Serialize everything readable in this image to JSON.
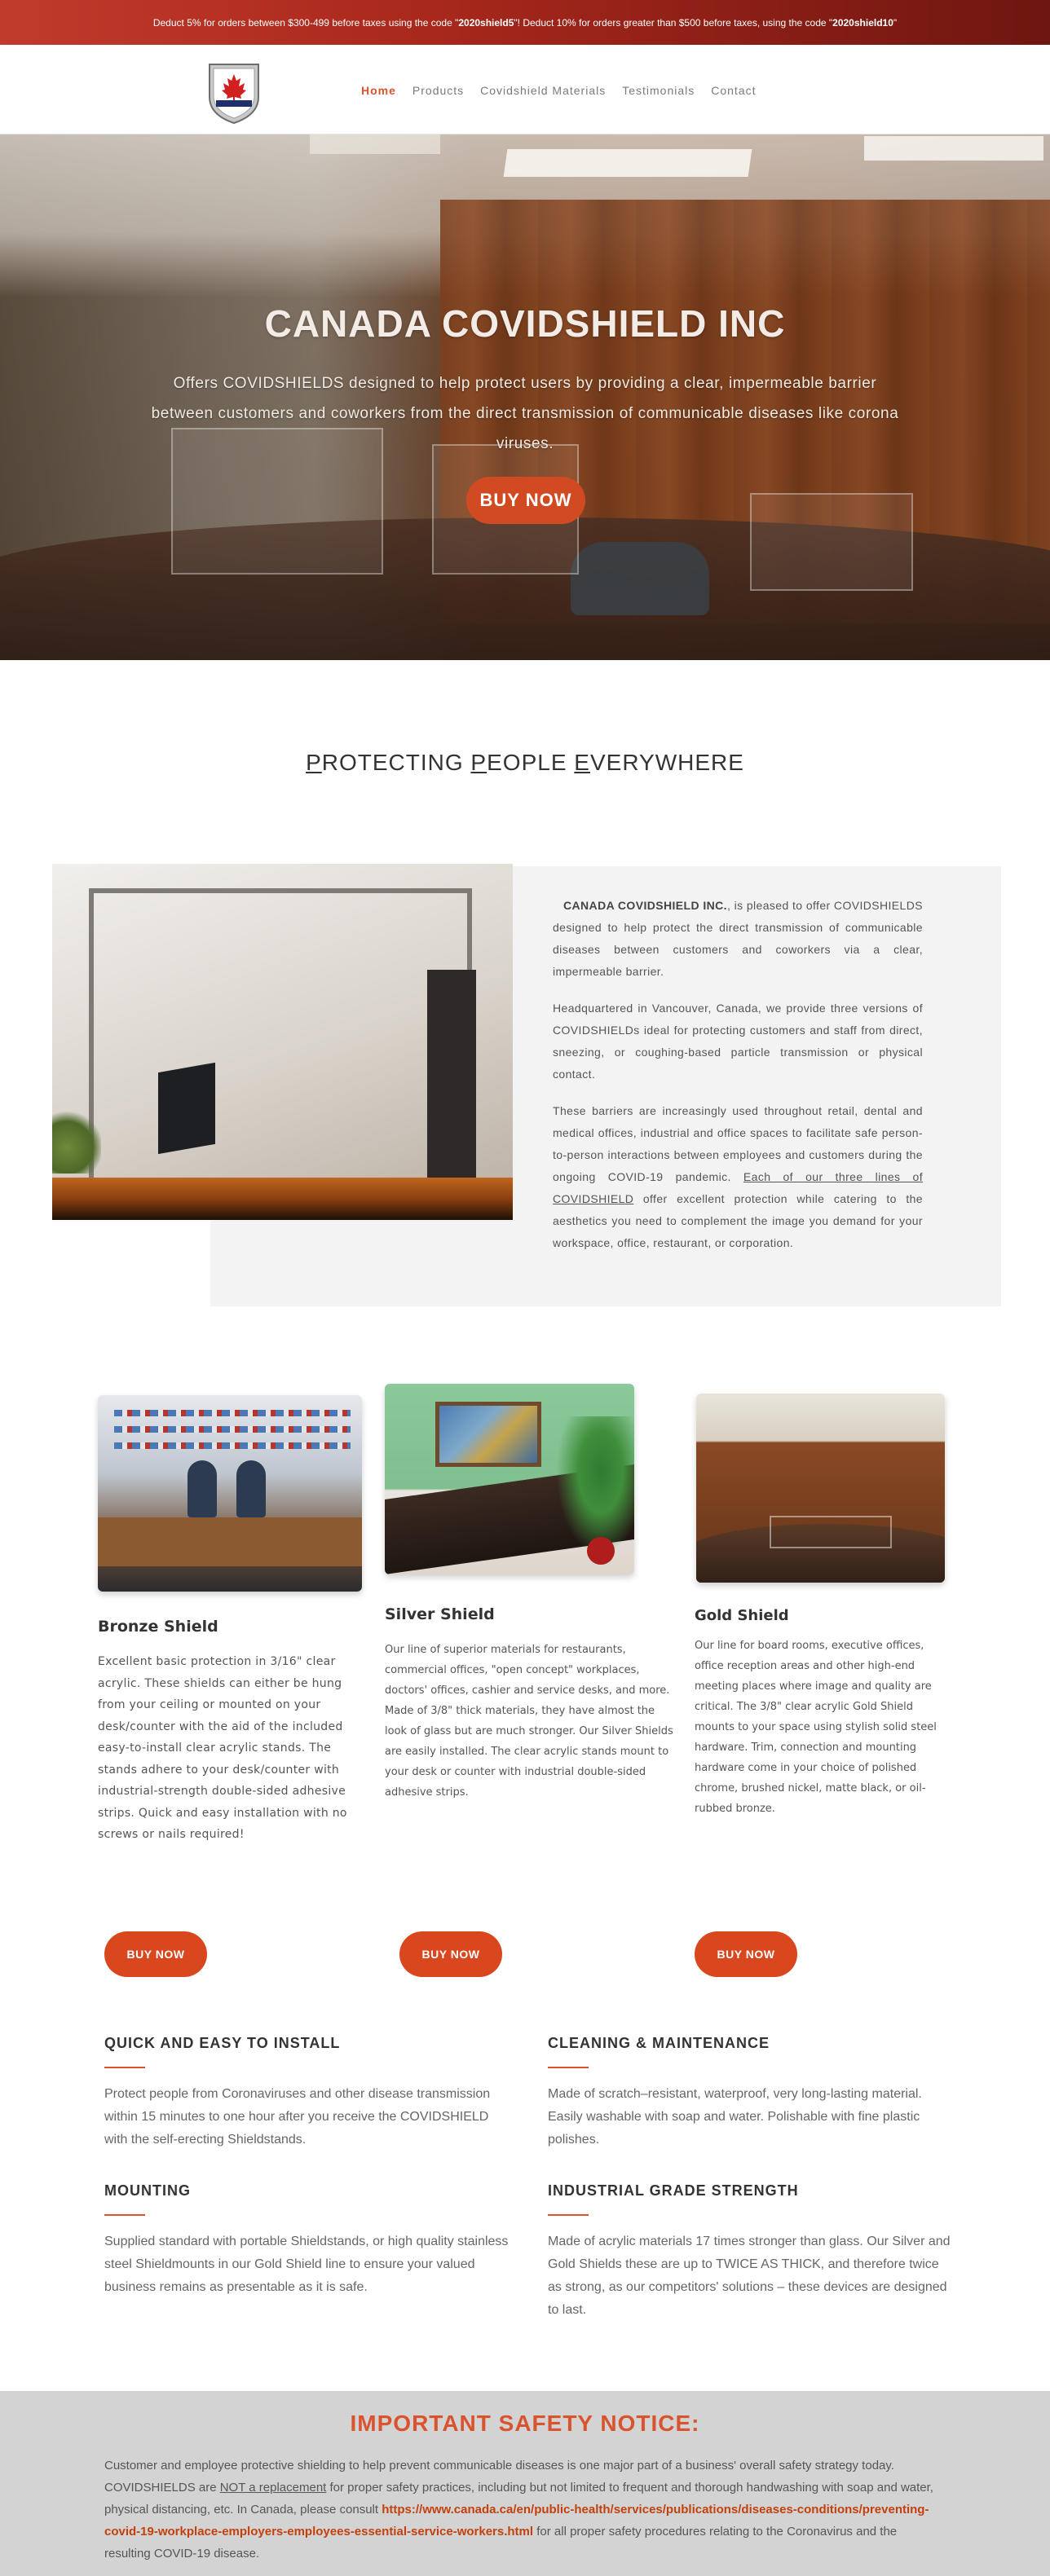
{
  "promo": {
    "part1": "Deduct 5% for orders between $300-499 before taxes using the code \"",
    "code1": "2020shield5",
    "part2": "\"! Deduct 10% for orders greater than $500 before taxes, using the code \"",
    "code2": "2020shield10",
    "part3": "\""
  },
  "nav": {
    "items": [
      "Home",
      "Products",
      "Covidshield Materials",
      "Testimonials",
      "Contact"
    ],
    "active": "Home"
  },
  "hero": {
    "title": "CANADA COVIDSHIELD INC",
    "text": "Offers COVIDSHIELDS designed to help protect users by providing a clear, impermeable barrier between customers and coworkers from the direct transmission of communicable diseases like corona viruses.",
    "button": "BUY NOW"
  },
  "tagline": {
    "p": "P",
    "rotecting": "ROTECTING ",
    "p2": "P",
    "eople": "EOPLE ",
    "e": "E",
    "verywhere": "VERYWHERE"
  },
  "about": {
    "company": "CANADA COVIDSHIELD INC.",
    "p1_rest": ", is pleased to offer COVIDSHIELDS designed to help protect the direct transmission of communicable diseases between customers and coworkers via a clear, impermeable barrier.",
    "p2": "Headquartered in Vancouver, Canada, we provide three versions of COVIDSHIELDs ideal for protecting customers and staff from direct, sneezing, or coughing-based particle transmission or physical contact.",
    "p3_start": "These barriers are increasingly used throughout retail, dental and medical offices, industrial and office spaces to facilitate safe person-to-person interactions between employees and customers during the ongoing COVID-19 pandemic. ",
    "p3_link": "Each of our three lines of COVIDSHIELD",
    "p3_end": " offer excellent protection while catering to the aesthetics you need to complement the image you demand for your workspace, office, restaurant, or corporation."
  },
  "products": [
    {
      "title": "Bronze Shield",
      "desc": "Excellent basic protection in 3/16\" clear acrylic.  These shields can either be hung from your ceiling or mounted on your desk/counter with the aid of the included easy-to-install clear acrylic stands.  The stands adhere to your desk/counter with industrial-strength double-sided adhesive strips.  Quick and easy installation with no screws or nails required!",
      "button": "BUY NOW"
    },
    {
      "title": "Silver Shield",
      "desc": "Our line of superior materials for restaurants, commercial offices, \"open concept\" workplaces, doctors' offices, cashier and service desks, and more.  Made of  3/8\" thick materials, they have almost the look of glass but are much stronger.  Our Silver Shields are easily installed.  The clear acrylic stands mount to your desk or counter with industrial double-sided adhesive strips.",
      "button": "BUY NOW"
    },
    {
      "title": "Gold Shield",
      "desc": "Our line for board rooms, executive offices, office reception areas and other high-end meeting places where image and quality are critical. The 3/8\" clear acrylic Gold Shield mounts to your space using stylish solid steel hardware. Trim, connection and mounting hardware come in your choice of polished chrome, brushed nickel, matte black, or oil-rubbed bronze.",
      "button": "BUY NOW"
    }
  ],
  "features": [
    {
      "title": "QUICK AND EASY TO INSTALL",
      "text": "Protect people from Coronaviruses and other disease transmission within 15 minutes to one hour after you receive the COVIDSHIELD with the self-erecting Shieldstands."
    },
    {
      "title": "CLEANING & MAINTENANCE",
      "text": "Made of scratch–resistant, waterproof, very long-lasting material. Easily washable with soap and water. Polishable with fine plastic polishes."
    },
    {
      "title": "MOUNTING",
      "text": "Supplied standard with portable Shieldstands, or high quality stainless steel Shieldmounts in our Gold Shield line to ensure your valued business remains as presentable as it is safe."
    },
    {
      "title": "INDUSTRIAL GRADE STRENGTH",
      "text": "Made of acrylic materials 17 times stronger than glass. Our Silver and Gold Shields these are up to TWICE AS THICK, and therefore twice as strong, as our competitors' solutions – these devices are designed to last."
    }
  ],
  "notice": {
    "title": "IMPORTANT SAFETY NOTICE:",
    "t1": "Customer and employee protective shielding to help prevent communicable diseases is one major part of a business' overall safety strategy today. COVIDSHIELDS are ",
    "t2": "NOT a replacement",
    "t3": " for proper safety practices, including but not limited to frequent and thorough handwashing with soap and water, physical distancing, etc. In Canada, please consult ",
    "link": "https://www.canada.ca/en/public-health/services/publications/diseases-conditions/preventing-covid-19-workplace-employers-employees-essential-service-workers.html",
    "t4": " for all proper safety procedures relating to the Coronavirus and the resulting COVID-19 disease."
  },
  "colors": {
    "accent": "#d9532f",
    "button": "#d24a22",
    "topbar": "#b0301f",
    "notice_bg": "#d3d3d3"
  }
}
